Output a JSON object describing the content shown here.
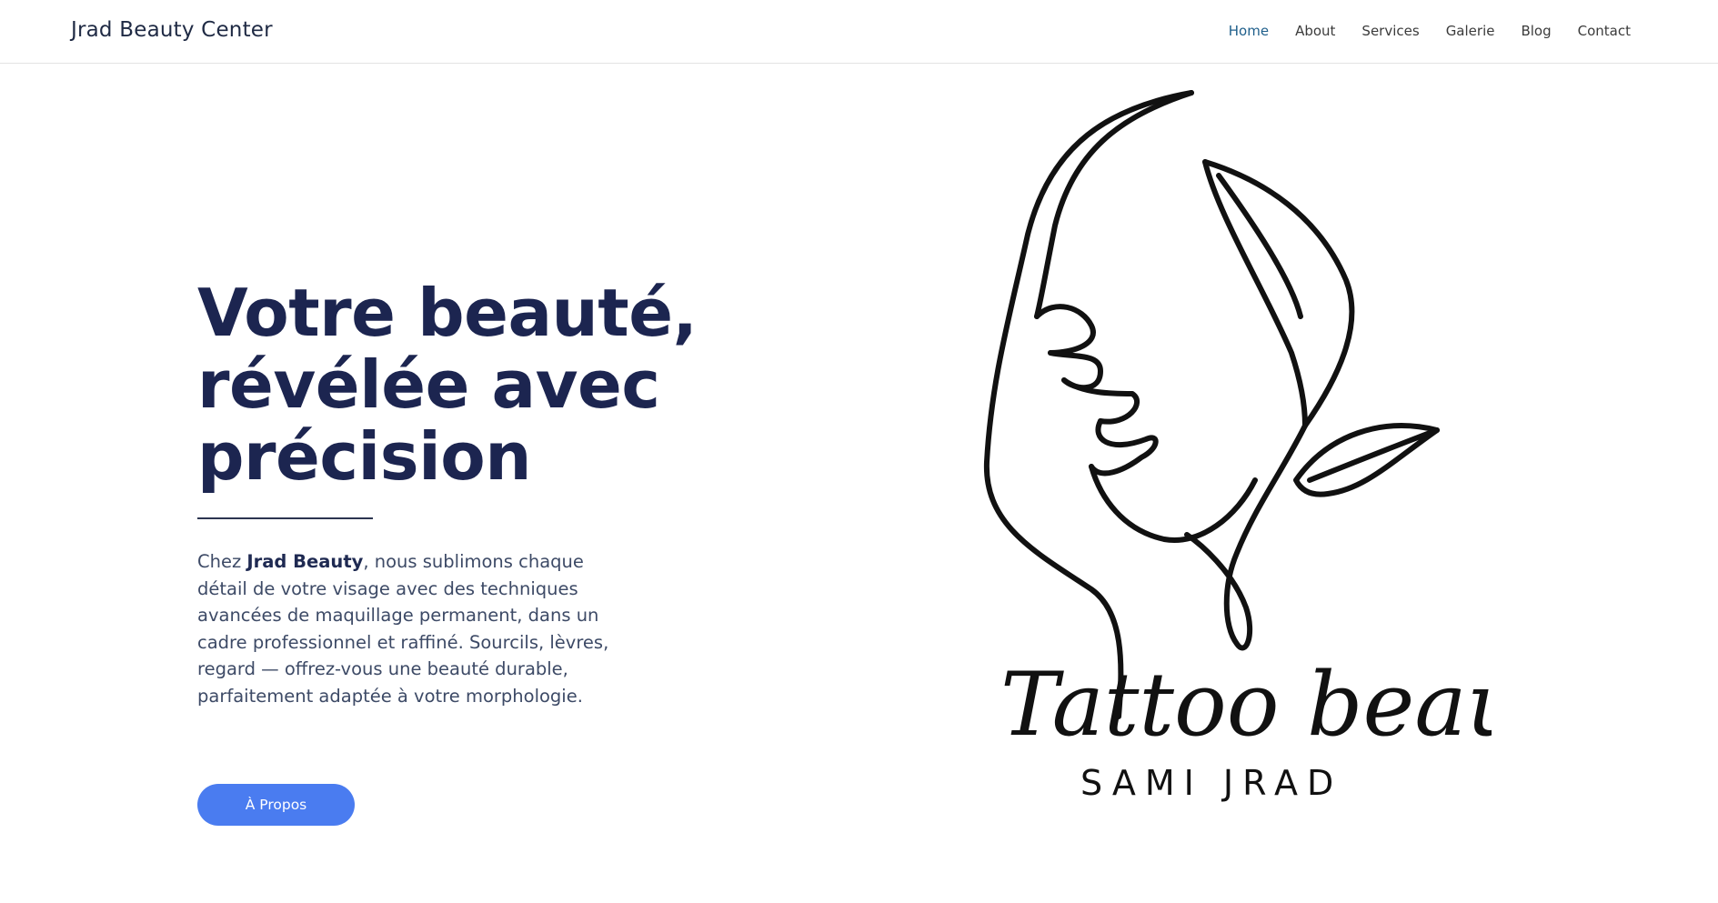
{
  "header": {
    "brand": "Jrad Beauty Center",
    "nav": [
      {
        "label": "Home",
        "active": true
      },
      {
        "label": "About"
      },
      {
        "label": "Services"
      },
      {
        "label": "Galerie"
      },
      {
        "label": "Blog"
      },
      {
        "label": "Contact"
      }
    ]
  },
  "hero": {
    "title_line1": "Votre beauté,",
    "title_line2": "révélée avec",
    "title_line3": "précision",
    "desc_prefix": "Chez ",
    "desc_brand": "Jrad Beauty",
    "desc_rest": ", nous sublimons chaque détail de votre visage avec des techniques avancées de maquillage permanent, dans un cadre professionnel et raffiné. Sourcils, lèvres, regard — offrez-vous une beauté durable, parfaitement adaptée à votre morphologie.",
    "cta_label": "À Propos"
  },
  "logo": {
    "script_text": "Tattoo beauty",
    "subtitle": "SAMI JRAD"
  },
  "colors": {
    "title": "#1c2550",
    "accent": "#4a7cf0",
    "nav_active": "#1f5f8b"
  }
}
